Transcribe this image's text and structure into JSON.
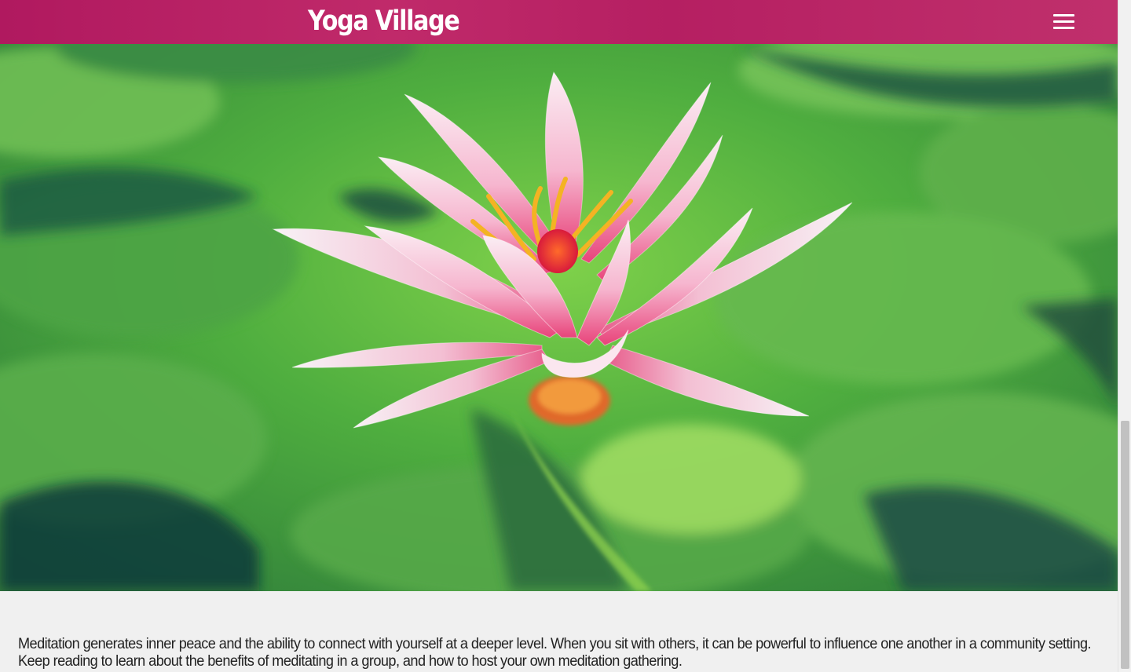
{
  "navbar": {
    "brand": "Yoga Village",
    "menu_icon": "hamburger-menu-icon",
    "color": "#b51f62"
  },
  "hero": {
    "image": "pink-water-lily-on-lily-pads",
    "petal_color": "#f4a6c4",
    "leaf_color": "#3f9a3a"
  },
  "intro": {
    "text": "Meditation generates inner peace and the ability to connect with yourself at a deeper level. When you sit with others, it can be powerful to influence one another in a community setting. Keep reading to learn about the benefits of meditating in a group, and how to host your own meditation gathering."
  }
}
